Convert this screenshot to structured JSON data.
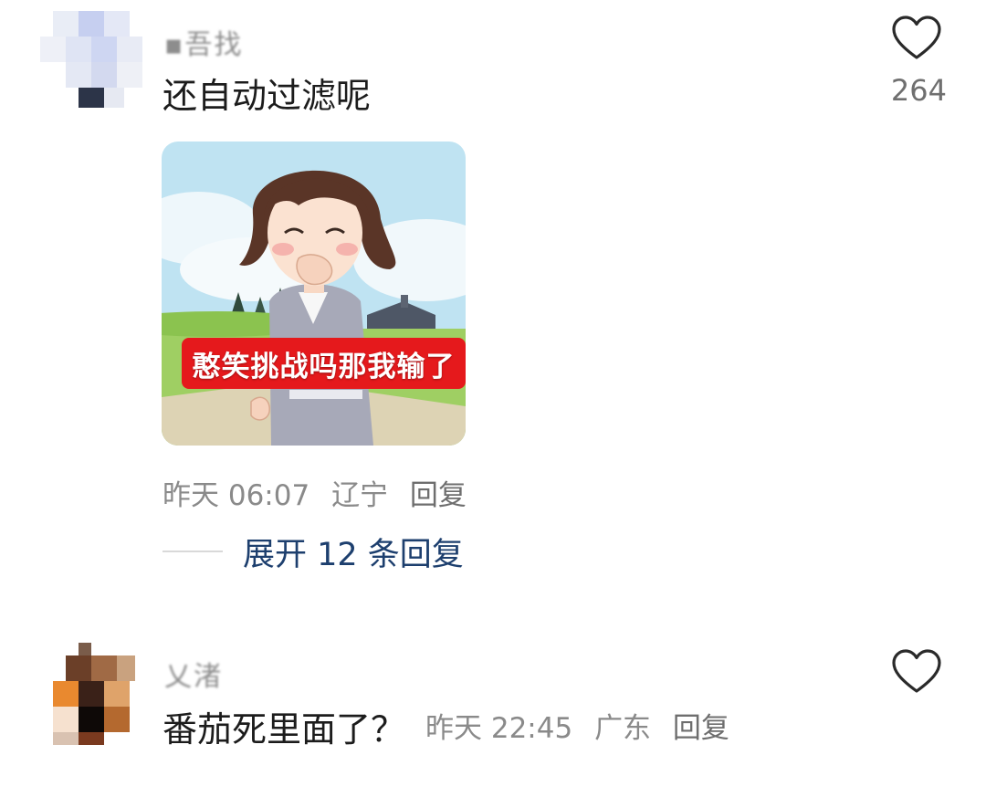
{
  "comments": [
    {
      "username": "▪吾找",
      "text": "还自动过滤呢",
      "like_count": "264",
      "meme_caption": "憨笑挑战吗那我输了",
      "time": "昨天 06:07",
      "location": "辽宁",
      "reply_label": "回复",
      "expand_label": "展开 12 条回复"
    },
    {
      "username": "乂渚",
      "text": "番茄死里面了？",
      "time": "昨天 22:45",
      "location": "广东",
      "reply_label": "回复"
    }
  ],
  "icons": {
    "like": "heart-outline-icon"
  },
  "colors": {
    "link": "#1d3f6e",
    "meta": "#8a8a8a",
    "caption_bg": "#e5191c"
  }
}
